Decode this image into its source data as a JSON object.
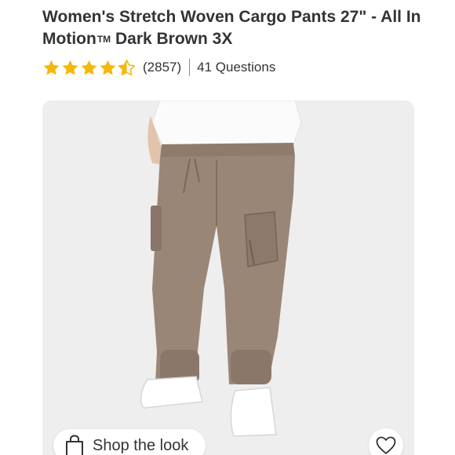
{
  "product": {
    "title_main": "Women's Stretch Woven Cargo Pants 27\" - All In Motion",
    "trademark": "TM",
    "title_tail": " Dark Brown 3X"
  },
  "rating": {
    "stars": 4.5,
    "star_color": "#f5b70a",
    "review_count": "(2857)",
    "questions": "41 Questions"
  },
  "actions": {
    "shop_the_look": "Shop the look"
  },
  "colors": {
    "pants": "#9a8676",
    "background": "#eeeeee",
    "text": "#333333"
  }
}
